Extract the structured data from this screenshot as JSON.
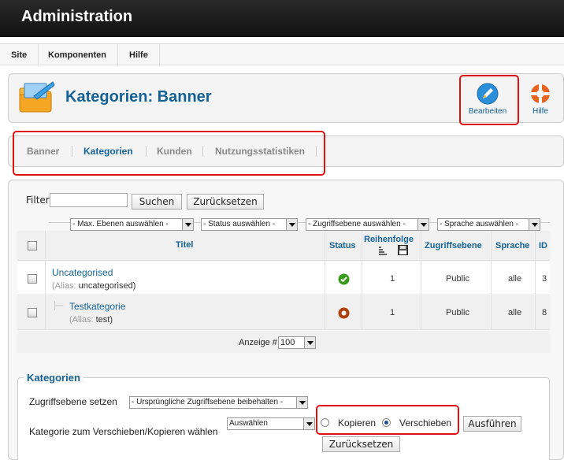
{
  "header": {
    "title": "Administration"
  },
  "menu": {
    "items": [
      "Site",
      "Komponenten",
      "Hilfe"
    ]
  },
  "toolbar": {
    "page_title": "Kategorien: Banner",
    "edit_label": "Bearbeiten",
    "help_label": "Hilfe"
  },
  "subnav": {
    "tabs": [
      "Banner",
      "Kategorien",
      "Kunden",
      "Nutzungsstatistiken"
    ],
    "active": "Kategorien"
  },
  "filter": {
    "label": "Filter:",
    "value": "",
    "search_button": "Suchen",
    "reset_button": "Zurücksetzen",
    "selects": [
      "- Max. Ebenen auswählen -",
      "- Status auswählen -",
      "- Zugriffsebene auswählen -",
      "- Sprache auswählen -"
    ]
  },
  "table": {
    "headers": {
      "title": "Titel",
      "status": "Status",
      "order": "Reihenfolge",
      "access": "Zugriffsebene",
      "language": "Sprache",
      "id": "ID"
    },
    "rows": [
      {
        "title": "Uncategorised",
        "alias_label": "(Alias:",
        "alias": "uncategorised)",
        "status": "published",
        "order": "1",
        "access": "Public",
        "language": "alle",
        "id": "3"
      },
      {
        "title": "Testkategorie",
        "alias_label": "(Alias:",
        "alias": "test)",
        "status": "unpublished",
        "order": "1",
        "access": "Public",
        "language": "alle",
        "id": "8"
      }
    ]
  },
  "pagination": {
    "label": "Anzeige #",
    "value": "100"
  },
  "batch": {
    "legend": "Kategorien",
    "access_label": "Zugriffsebene setzen",
    "access_select": "- Ursprüngliche Zugriffsebene beibehalten -",
    "move_label": "Kategorie zum Verschieben/Kopieren wählen",
    "move_select": "Auswählen",
    "copy_label": "Kopieren",
    "move_radio_label": "Verschieben",
    "move_selected": "move",
    "execute_button": "Ausführen",
    "reset_button": "Zurücksetzen"
  },
  "colors": {
    "accent": "#146295",
    "highlight": "#e01010",
    "published": "#3a9a1a",
    "unpublished": "#b04010"
  }
}
